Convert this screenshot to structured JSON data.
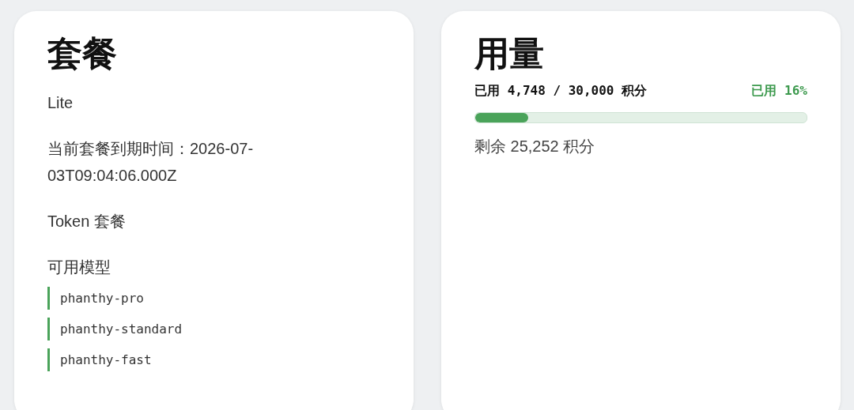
{
  "plan": {
    "title": "套餐",
    "name": "Lite",
    "expiry": "当前套餐到期时间：2026-07-03T09:04:06.000Z",
    "type": "Token 套餐",
    "models_label": "可用模型",
    "models": [
      "phanthy-pro",
      "phanthy-standard",
      "phanthy-fast"
    ]
  },
  "usage": {
    "title": "用量",
    "used_text": "已用 4,748 / 30,000 积分",
    "percent_text": "已用 16%",
    "level": 0.16,
    "remaining": "剩余 25,252 积分"
  }
}
